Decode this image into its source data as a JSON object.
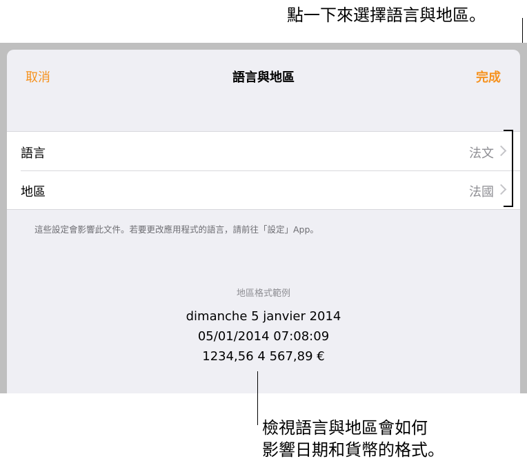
{
  "callouts": {
    "top": "點一下來選擇語言與地區。",
    "bottom_line1": "檢視語言與地區會如何",
    "bottom_line2": "影響日期和貨幣的格式。"
  },
  "nav": {
    "cancel_label": "取消",
    "title": "語言與地區",
    "done_label": "完成"
  },
  "settings": {
    "rows": [
      {
        "label": "語言",
        "value": "法文"
      },
      {
        "label": "地區",
        "value": "法國"
      }
    ],
    "footnote": "這些設定會影響此文件。若要更改應用程式的語言，請前往「設定」App。"
  },
  "example": {
    "heading": "地區格式範例",
    "lines": [
      "dimanche 5 janvier 2014",
      "05/01/2014    07:08:09",
      "1234,56    4 567,89 €"
    ]
  },
  "colors": {
    "accent": "#f6921e",
    "sheet_bg": "#efeff4",
    "dim_backdrop": "#bfbfbf"
  }
}
